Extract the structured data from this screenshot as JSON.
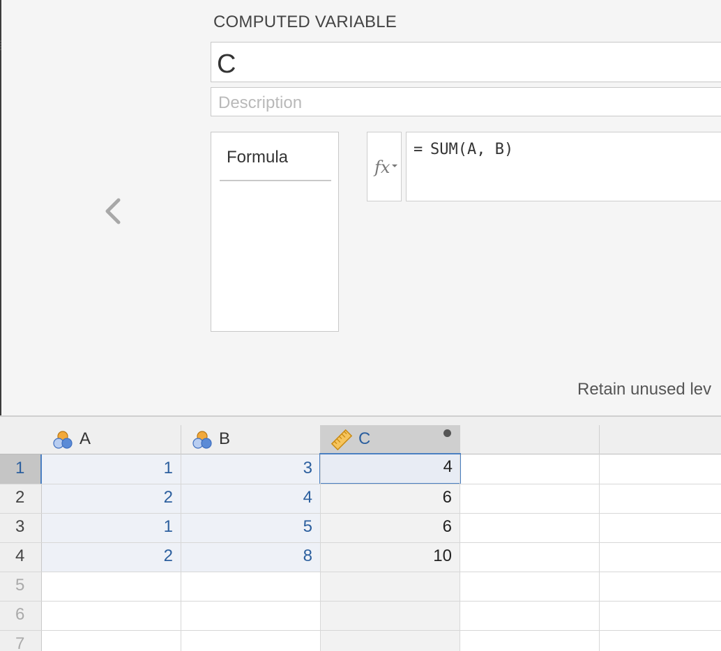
{
  "editor": {
    "title": "COMPUTED VARIABLE",
    "name_value": "C",
    "description_placeholder": "Description",
    "formula_tab": "Formula",
    "formula_prefix": "=",
    "formula_expression": "SUM(A, B)",
    "fx_label": "fx",
    "retain_label": "Retain unused lev"
  },
  "sheet": {
    "columns": [
      {
        "name": "A",
        "type": "nominal-icon"
      },
      {
        "name": "B",
        "type": "nominal-icon"
      },
      {
        "name": "C",
        "type": "continuous-ruler-icon"
      }
    ],
    "row_numbers": [
      "1",
      "2",
      "3",
      "4",
      "5",
      "6",
      "7"
    ],
    "rows": [
      [
        "1",
        "3",
        "4"
      ],
      [
        "2",
        "4",
        "6"
      ],
      [
        "1",
        "5",
        "6"
      ],
      [
        "2",
        "8",
        "10"
      ]
    ]
  },
  "colors": {
    "accent_blue": "#4a7fc1",
    "value_blue": "#2c5f9e",
    "nominal_orange": "#f2a93b",
    "nominal_blue": "#5b8bd6"
  }
}
